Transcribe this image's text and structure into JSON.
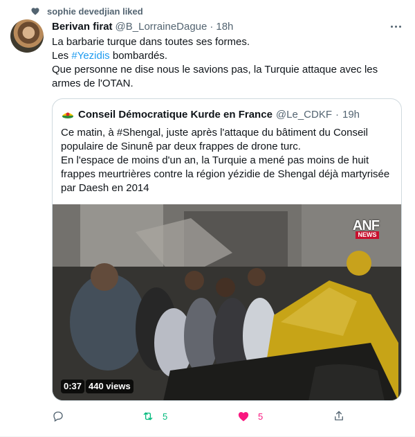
{
  "social_context": {
    "text": "sophie devedjian liked",
    "icon": "heart-icon"
  },
  "tweet": {
    "author_name": "Berivan firat",
    "handle": "@B_LorraineDague",
    "separator": "·",
    "time": "18h",
    "lines": [
      "La  barbarie turque dans toutes ses formes.",
      "Que personne ne dise nous le savions pas, la Turquie attaque avec les",
      "armes de l'OTAN."
    ],
    "line2": {
      "hashtag": "#Yezidis",
      "prefix": "Les ",
      "suffix": " bombardés."
    }
  },
  "quote": {
    "author_name": "Conseil Démocratique Kurde en France",
    "handle": "@Le_CDKF",
    "separator": "·",
    "time": "19h",
    "lines": [
      "Ce matin, à #Shengal, juste après l'attaque du bâtiment du Conseil",
      "populaire de Sinunê par deux frappes de drone turc.",
      "En l'espace de moins d'un an, la Turquie a mené pas moins de huit",
      "frappes meurtrières contre la région yézidie de Shengal déjà martyrisée",
      "par Daesh en 2014"
    ],
    "video": {
      "duration": "0:37",
      "views": "440 views",
      "watermark": "ANF",
      "watermark_sub": "NEWS"
    }
  },
  "actions": {
    "reply_icon": "reply-icon",
    "retweet_count": "5",
    "like_count": "5",
    "share_icon": "share-icon"
  },
  "colors": {
    "accent": "#1d9bf0",
    "retweet": "#00ba7c",
    "like": "#f91880",
    "secondary_text": "#536471",
    "border": "#cfd9de"
  }
}
